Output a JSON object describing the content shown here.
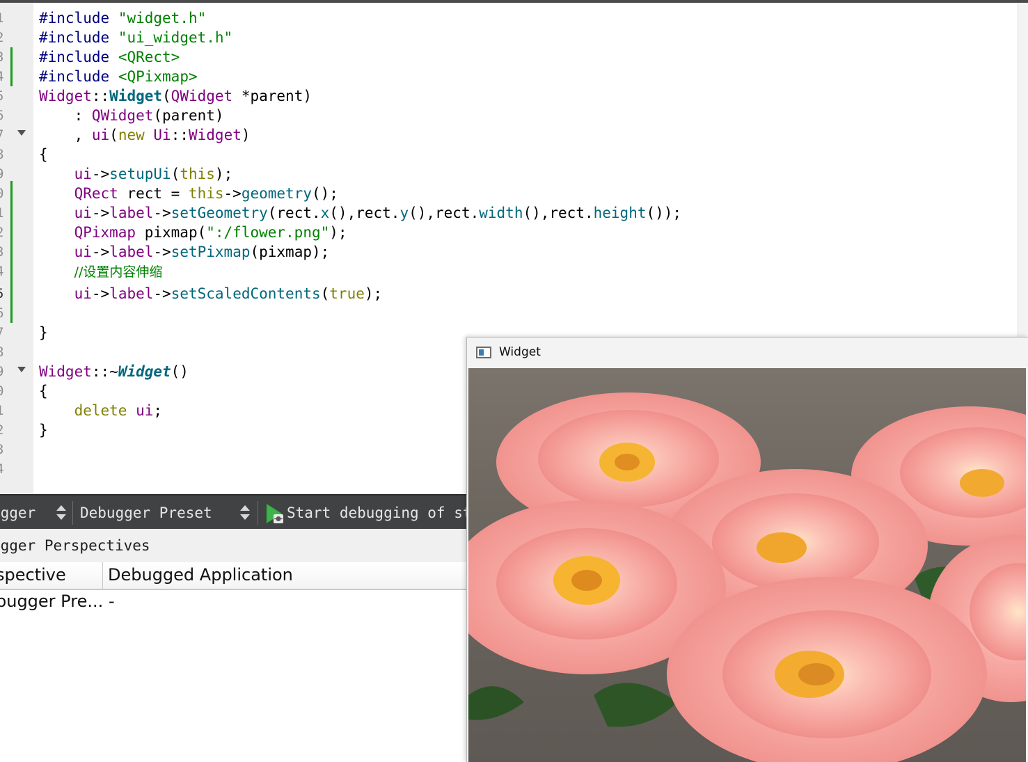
{
  "editor": {
    "line_numbers": [
      "1",
      "2",
      "3",
      "4",
      "5",
      "6",
      "7",
      "8",
      "9",
      "0",
      "1",
      "2",
      "3",
      "4",
      "5",
      "6",
      "7",
      "8",
      "9",
      "0",
      "1",
      "2",
      "3",
      "4"
    ],
    "current_line_index": 14,
    "code": {
      "l1_pp": "#include",
      "l1_str": "\"widget.h\"",
      "l2_pp": "#include",
      "l2_str": "\"ui_widget.h\"",
      "l3_pp": "#include",
      "l3_str": "<QRect>",
      "l4_pp": "#include",
      "l4_str": "<QPixmap>",
      "l5_cls": "Widget",
      "l5_sep": "::",
      "l5_fn": "Widget",
      "l5_open": "(",
      "l5_type": "QWidget",
      "l5_rest": " *parent)",
      "l6_colon": "    : ",
      "l6_cls": "QWidget",
      "l6_rest": "(parent)",
      "l7_comma": "    , ",
      "l7_member": "ui",
      "l7_open": "(",
      "l7_new": "new",
      "l7_sp": " ",
      "l7_ns": "Ui",
      "l7_sep": "::",
      "l7_cls": "Widget",
      "l7_close": ")",
      "l8": "{",
      "l9_ind": "    ",
      "l9_member": "ui",
      "l9_arrow": "->",
      "l9_fn": "setupUi",
      "l9_open": "(",
      "l9_kw": "this",
      "l9_close": ");",
      "l10_ind": "    ",
      "l10_cls": "QRect",
      "l10_mid": " rect = ",
      "l10_kw": "this",
      "l10_arrow": "->",
      "l10_fn": "geometry",
      "l10_close": "();",
      "l11_ind": "    ",
      "l11_member": "ui",
      "l11_arrow1": "->",
      "l11_label": "label",
      "l11_arrow2": "->",
      "l11_fn": "setGeometry",
      "l11_a": "(rect.",
      "l11_x": "x",
      "l11_b": "(),rect.",
      "l11_y": "y",
      "l11_c": "(),rect.",
      "l11_w": "width",
      "l11_d": "(),rect.",
      "l11_h": "height",
      "l11_e": "());",
      "l12_ind": "    ",
      "l12_cls": "QPixmap",
      "l12_mid": " pixmap(",
      "l12_str": "\":/flower.png\"",
      "l12_close": ");",
      "l13_ind": "    ",
      "l13_member": "ui",
      "l13_arrow1": "->",
      "l13_label": "label",
      "l13_arrow2": "->",
      "l13_fn": "setPixmap",
      "l13_rest": "(pixmap);",
      "l14_ind": "    ",
      "l14_comment": "//设置内容伸缩",
      "l15_ind": "    ",
      "l15_member": "ui",
      "l15_arrow1": "->",
      "l15_label": "label",
      "l15_arrow2": "->",
      "l15_fn": "setScaledContents",
      "l15_open": "(",
      "l15_kw": "true",
      "l15_close": ");",
      "l17": "}",
      "l19_cls": "Widget",
      "l19_sep": "::~",
      "l19_fn": "Widget",
      "l19_rest": "()",
      "l20": "{",
      "l21_ind": "    ",
      "l21_kw": "delete",
      "l21_sp": " ",
      "l21_member": "ui",
      "l21_rest": ";",
      "l22": "}"
    }
  },
  "toolbar": {
    "debugger_combo": "ugger",
    "preset_combo": "Debugger Preset",
    "start_label": "Start debugging of sta"
  },
  "perspectives": {
    "title": "ugger Perspectives",
    "columns": [
      "spective",
      "Debugged Application"
    ],
    "rows": [
      {
        "perspective": "bugger Pre...",
        "application": "-"
      }
    ]
  },
  "widget_window": {
    "title": "Widget",
    "content": "rose-photo"
  },
  "colors": {
    "preprocessor": "#000080",
    "string": "#008000",
    "keyword": "#808000",
    "class": "#800080",
    "function": "#00677c",
    "toolbar_bg": "#404244",
    "change_marker": "#1a9a1a"
  }
}
